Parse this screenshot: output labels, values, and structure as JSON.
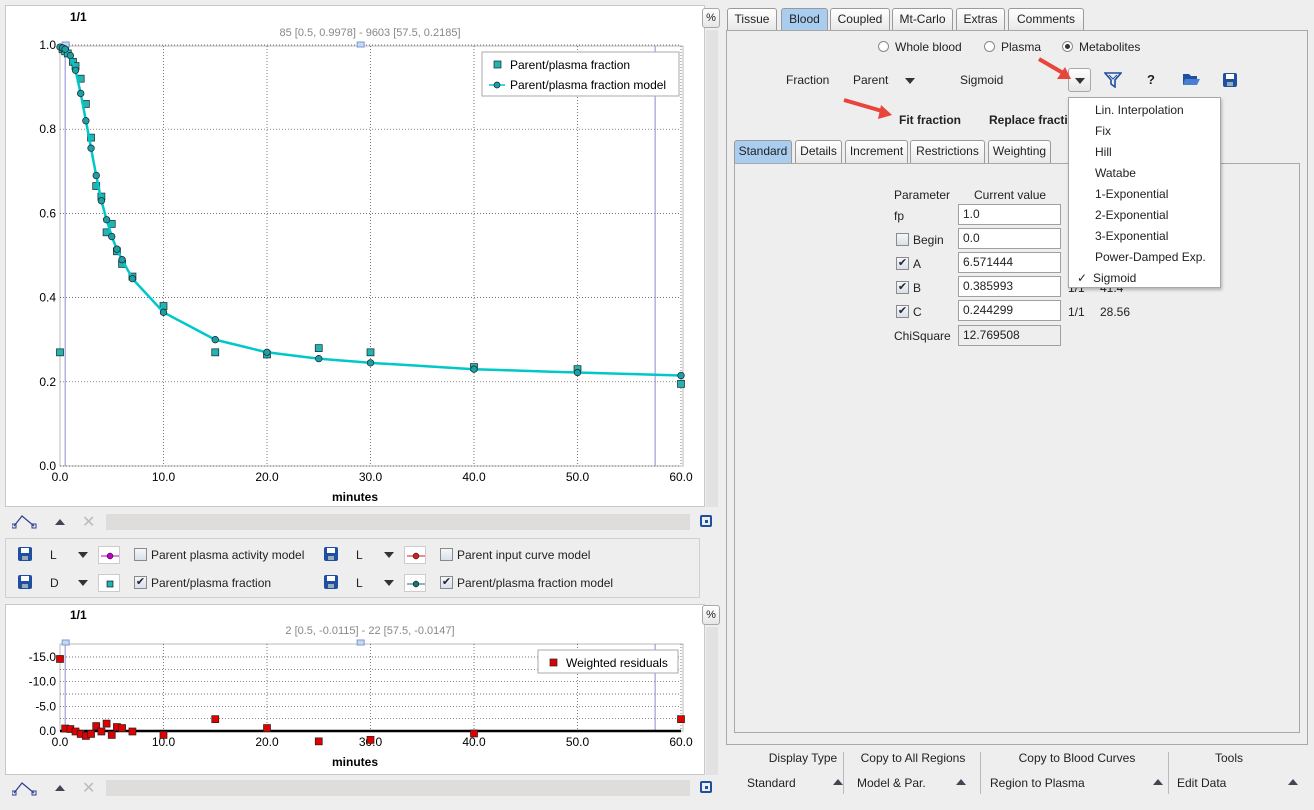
{
  "main_chart": {
    "page_label": "1/1",
    "range_label": "85 [0.5, 0.9978] - 9603 [57.5, 0.2185]",
    "percent_button": "%",
    "xlabel": "minutes",
    "x_ticks": [
      "0.0",
      "10.0",
      "20.0",
      "30.0",
      "40.0",
      "50.0",
      "60.0"
    ],
    "y_ticks": [
      "0.0",
      "0.2",
      "0.4",
      "0.6",
      "0.8",
      "1.0"
    ],
    "legend": [
      "Parent/plasma fraction",
      "Parent/plasma fraction model"
    ]
  },
  "residual_chart": {
    "page_label": "1/1",
    "range_label": "2 [0.5, -0.0115] - 22 [57.5, -0.0147]",
    "percent_button": "%",
    "xlabel": "minutes",
    "x_ticks": [
      "0.0",
      "10.0",
      "20.0",
      "30.0",
      "40.0",
      "50.0",
      "60.0"
    ],
    "y_ticks": [
      "0.0",
      "-5.0",
      "-10.0",
      "-15.0"
    ],
    "legend": [
      "Weighted residuals"
    ]
  },
  "chart_data": [
    {
      "type": "scatter",
      "xlabel": "minutes",
      "xlim": [
        0,
        60
      ],
      "ylim": [
        0,
        1.0
      ],
      "grid": true,
      "legend_position": "top-right",
      "series": [
        {
          "name": "Parent/plasma fraction",
          "marker": "square",
          "color": "#1fb5b5",
          "x": [
            0,
            0.25,
            0.5,
            0.75,
            1.25,
            1.5,
            2,
            2.5,
            3,
            3.5,
            4,
            4.5,
            5,
            5.5,
            6,
            7,
            10,
            15,
            20,
            25,
            30,
            40,
            50,
            60
          ],
          "y": [
            0.27,
            0.99,
            0.985,
            0.98,
            0.96,
            0.95,
            0.92,
            0.86,
            0.78,
            0.665,
            0.64,
            0.555,
            0.575,
            0.51,
            0.48,
            0.45,
            0.38,
            0.27,
            0.265,
            0.28,
            0.27,
            0.235,
            0.23,
            0.195
          ]
        },
        {
          "name": "Parent/plasma fraction model",
          "marker": "circle-line",
          "color": "#00c8c8",
          "x": [
            0,
            0.25,
            0.5,
            1,
            1.5,
            2,
            2.5,
            3,
            3.5,
            4,
            4.5,
            5,
            5.5,
            6,
            7,
            10,
            15,
            20,
            25,
            30,
            40,
            50,
            60
          ],
          "y": [
            0.995,
            0.993,
            0.99,
            0.975,
            0.94,
            0.885,
            0.82,
            0.755,
            0.69,
            0.63,
            0.585,
            0.545,
            0.515,
            0.49,
            0.445,
            0.365,
            0.3,
            0.27,
            0.255,
            0.245,
            0.23,
            0.222,
            0.215
          ]
        }
      ]
    },
    {
      "type": "scatter",
      "xlabel": "minutes",
      "xlim": [
        0,
        60
      ],
      "ylim": [
        -15,
        3
      ],
      "grid": true,
      "legend_position": "top-right",
      "series": [
        {
          "name": "Weighted residuals",
          "marker": "square",
          "color": "#e00000",
          "x": [
            0,
            0.5,
            1,
            1.5,
            2,
            2.5,
            3,
            3.5,
            4,
            4.5,
            5,
            5.5,
            6,
            7,
            10,
            15,
            20,
            25,
            30,
            40,
            60
          ],
          "y": [
            -14.6,
            -0.5,
            -0.4,
            0.1,
            0.6,
            1.0,
            0.6,
            -1.0,
            0.1,
            -1.5,
            0.8,
            -0.8,
            -0.6,
            0.1,
            0.8,
            -2.4,
            -0.6,
            2.1,
            1.8,
            0.5,
            -2.4
          ]
        }
      ]
    }
  ],
  "curve_rows": [
    {
      "style": "L",
      "label": "Parent plasma activity model",
      "checked": false,
      "swatch": "#c000c0"
    },
    {
      "style": "L",
      "label": "Parent input curve model",
      "checked": false,
      "swatch": "#d02020"
    },
    {
      "style": "D",
      "label": "Parent/plasma fraction",
      "checked": true,
      "swatch": "#1fb5b5"
    },
    {
      "style": "L",
      "label": "Parent/plasma fraction model",
      "checked": true,
      "swatch": "#1a7070"
    }
  ],
  "tabs": [
    "Tissue",
    "Blood",
    "Coupled",
    "Mt-Carlo",
    "Extras",
    "Comments"
  ],
  "selected_tab": "Blood",
  "radios": [
    "Whole blood",
    "Plasma",
    "Metabolites"
  ],
  "selected_radio": "Metabolites",
  "fraction": {
    "label": "Fraction",
    "value": "Parent",
    "model": "Sigmoid"
  },
  "help_label": "?",
  "fit_fraction": "Fit fraction",
  "replace_fraction": "Replace fracti",
  "subtabs": [
    "Standard",
    "Details",
    "Increment",
    "Restrictions",
    "Weighting"
  ],
  "params": {
    "header_parameter": "Parameter",
    "header_value": "Current value",
    "rows": [
      {
        "name": "fp",
        "value": "1.0",
        "checkbox": null
      },
      {
        "name": "Begin",
        "value": "0.0",
        "checkbox": false
      },
      {
        "name": "A",
        "value": "6.571444",
        "checkbox": true
      },
      {
        "name": "B",
        "value": "0.385993",
        "checkbox": true,
        "extra1": "1/1",
        "extra2": "41.4"
      },
      {
        "name": "C",
        "value": "0.244299",
        "checkbox": true,
        "extra1": "1/1",
        "extra2": "28.56"
      }
    ],
    "chisquare_label": "ChiSquare",
    "chisquare_value": "12.769508"
  },
  "model_menu": {
    "items": [
      "Lin. Interpolation",
      "Fix",
      "Hill",
      "Watabe",
      "1-Exponential",
      "2-Exponential",
      "3-Exponential",
      "Power-Damped Exp.",
      "Sigmoid"
    ],
    "selected": "Sigmoid",
    "check": "✓"
  },
  "bottom": [
    {
      "title": "Display Type",
      "value": "Standard"
    },
    {
      "title": "Copy to All Regions",
      "value": "Model & Par."
    },
    {
      "title": "Copy to Blood Curves",
      "value": "Region to Plasma"
    },
    {
      "title": "Tools",
      "value": "Edit Data"
    }
  ],
  "colors": {
    "accent_tab": "#a9cdef",
    "arrow": "#e8453c"
  }
}
